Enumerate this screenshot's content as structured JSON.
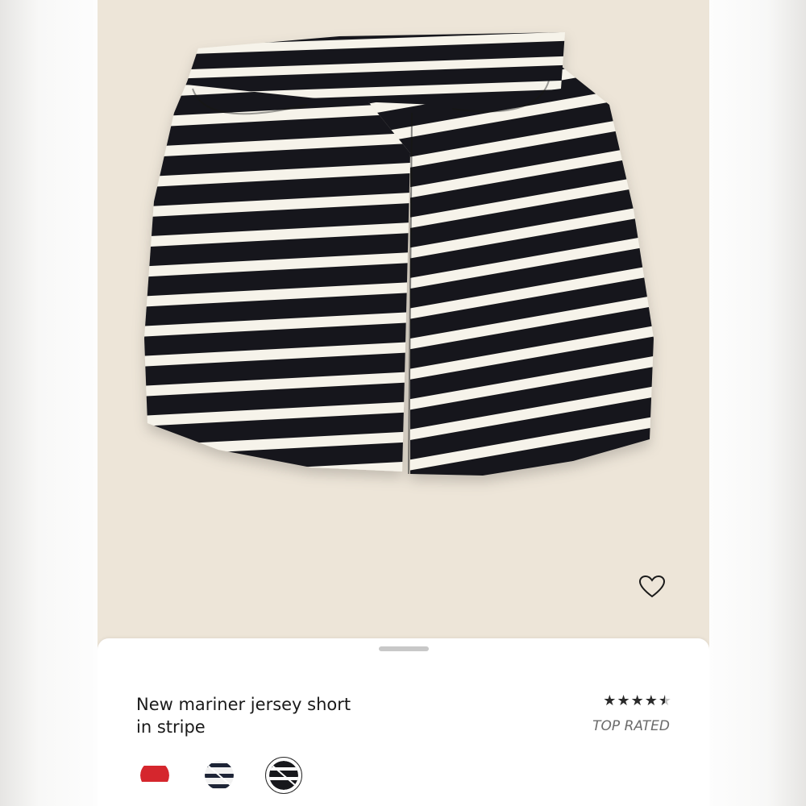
{
  "product": {
    "name_line1": "New mariner jersey short",
    "name_line2": "in stripe",
    "rating": 4.5,
    "rating_stars": [
      "★",
      "★",
      "★",
      "★",
      "★"
    ],
    "badge": "TOP RATED"
  },
  "colors": {
    "background": "#ede5d8",
    "stripe_dark": "#17181c",
    "stripe_light": "#f6f3ea"
  },
  "swatches": [
    {
      "name": "red-stripe",
      "colors": [
        "#d5262d",
        "#ffffff"
      ],
      "selected": false
    },
    {
      "name": "navy-white-stripe",
      "colors": [
        "#ffffff",
        "#1d2436"
      ],
      "selected": false
    },
    {
      "name": "black-white-stripe",
      "colors": [
        "#17181c",
        "#ffffff"
      ],
      "selected": true
    }
  ],
  "icons": {
    "wishlist": "heart-outline-icon",
    "sheet_handle": "drag-handle"
  }
}
